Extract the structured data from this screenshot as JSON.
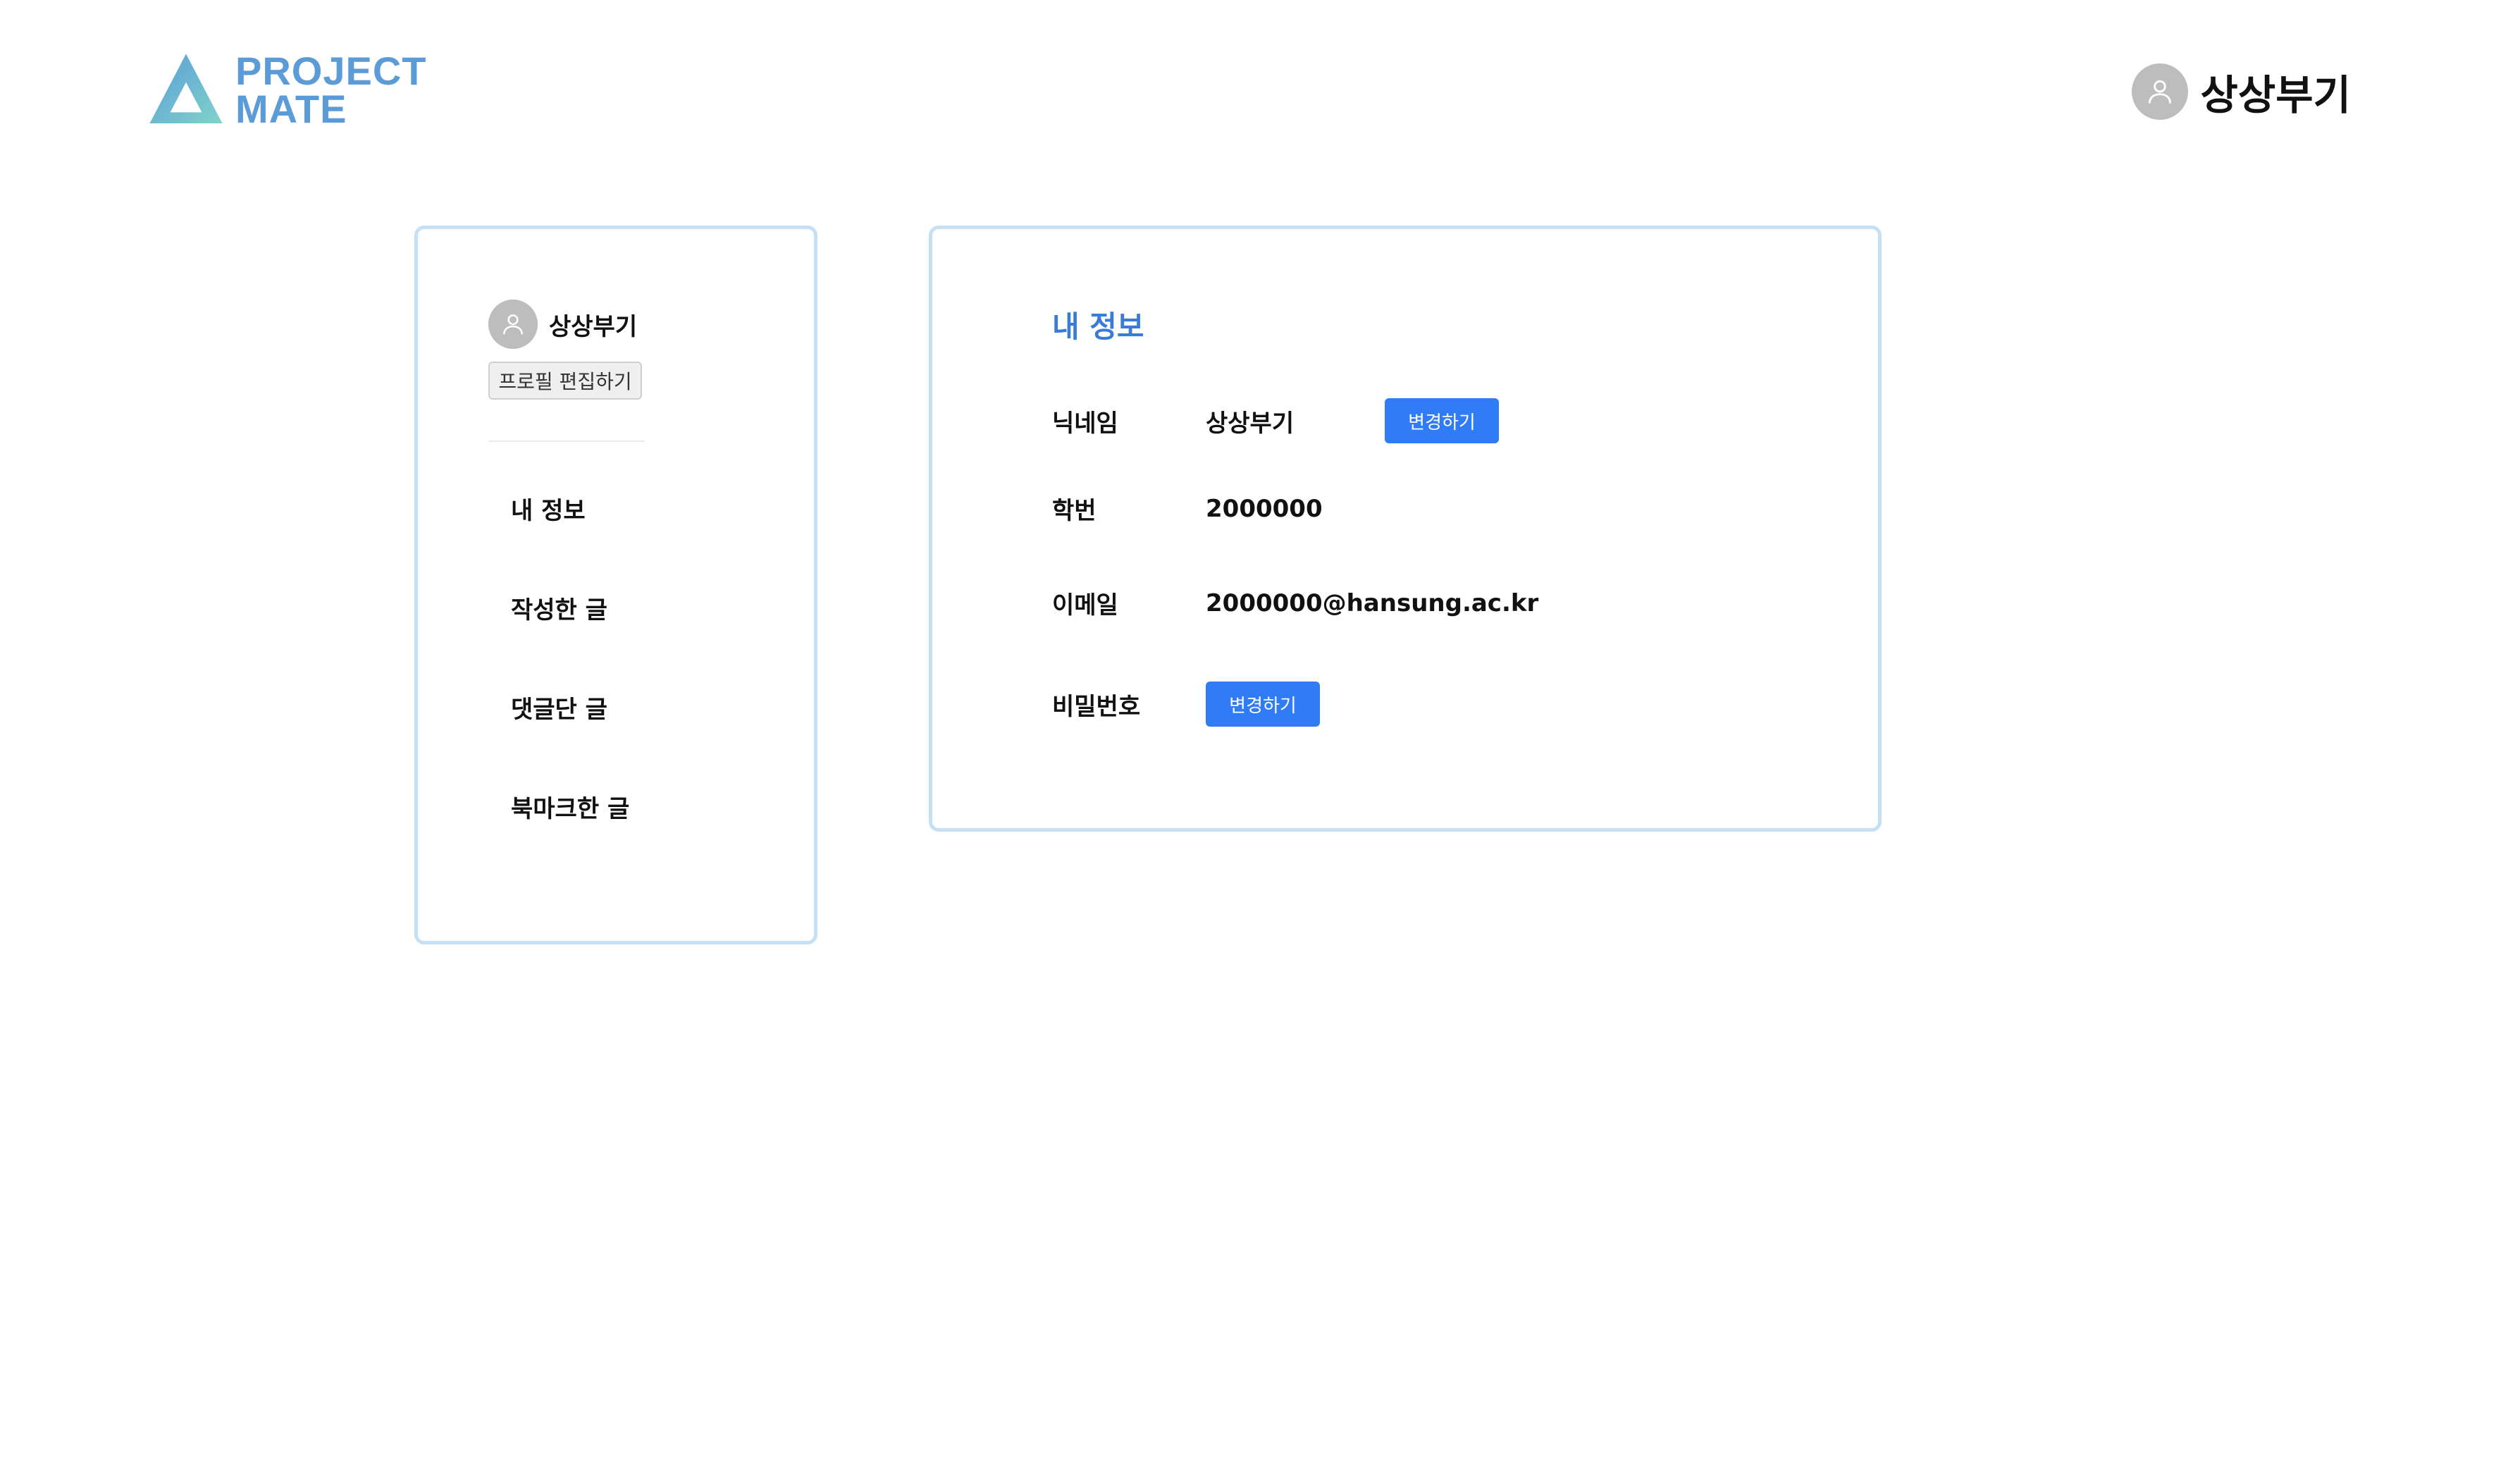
{
  "header": {
    "logo_line1": "PROJECT",
    "logo_line2": "MATE",
    "username": "상상부기"
  },
  "sidebar": {
    "username": "상상부기",
    "edit_profile_label": "프로필 편집하기",
    "menu": [
      {
        "label": "내 정보"
      },
      {
        "label": "작성한 글"
      },
      {
        "label": "댓글단 글"
      },
      {
        "label": "북마크한 글"
      }
    ]
  },
  "info": {
    "title": "내 정보",
    "nickname_label": "닉네임",
    "nickname_value": "상상부기",
    "nickname_change_label": "변경하기",
    "student_id_label": "학번",
    "student_id_value": "2000000",
    "email_label": "이메일",
    "email_value": "2000000@hansung.ac.kr",
    "password_label": "비밀번호",
    "password_change_label": "변경하기"
  },
  "colors": {
    "accent": "#2f7cf6",
    "title": "#3a7bd5",
    "card_border": "#c5dff5",
    "logo": "#5b9bd8",
    "avatar": "#bdbdbd"
  },
  "icons": {
    "logo": "triangle-logo-icon",
    "avatar": "user-icon"
  }
}
